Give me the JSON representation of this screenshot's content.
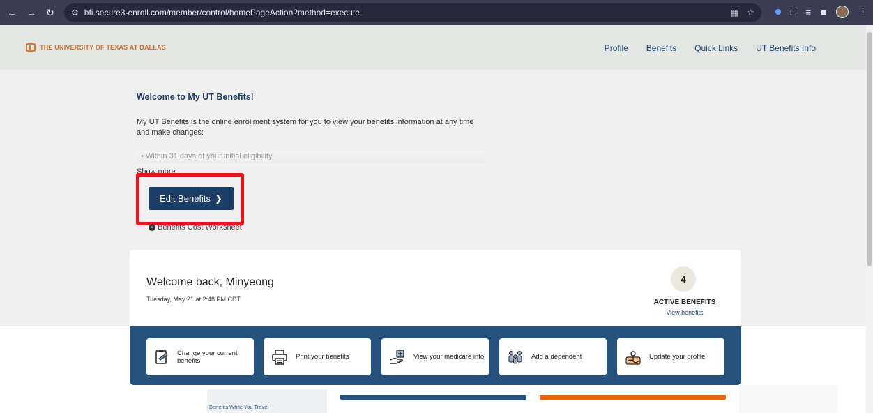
{
  "browser": {
    "url": "bfi.secure3-enroll.com/member/control/homePageAction?method=execute"
  },
  "header": {
    "brand": "THE UNIVERSITY OF TEXAS AT DALLAS",
    "nav": [
      "Profile",
      "Benefits",
      "Quick Links",
      "UT Benefits Info"
    ]
  },
  "hero": {
    "title": "Welcome to My UT Benefits!",
    "intro": "My UT Benefits is the online enrollment system for you to view your benefits information at any time and make changes:",
    "bullet": "• Within 31 days of your initial eligibility",
    "show_more": "Show more",
    "edit_button": "Edit Benefits",
    "worksheet_link": "Benefits Cost Worksheet"
  },
  "card": {
    "greeting": "Welcome back, Minyeong",
    "date": "Tuesday, May 21 at 2:48 PM CDT",
    "active_count": "4",
    "active_label": "ACTIVE BENEFITS",
    "view_link": "View benefits"
  },
  "quick_actions": [
    {
      "label": "Change your current benefits",
      "icon": "clipboard-edit-icon"
    },
    {
      "label": "Print your benefits",
      "icon": "printer-icon"
    },
    {
      "label": "View your medicare info",
      "icon": "medical-hand-icon"
    },
    {
      "label": "Add a dependent",
      "icon": "family-icon"
    },
    {
      "label": "Update your profile",
      "icon": "profile-map-icon"
    }
  ],
  "sidebar": {
    "item": "Benefits While You Travel"
  },
  "colors": {
    "navy": "#1b3d66",
    "band": "#24527d",
    "orange": "#e06a1c",
    "highlight": "#e8141c"
  }
}
